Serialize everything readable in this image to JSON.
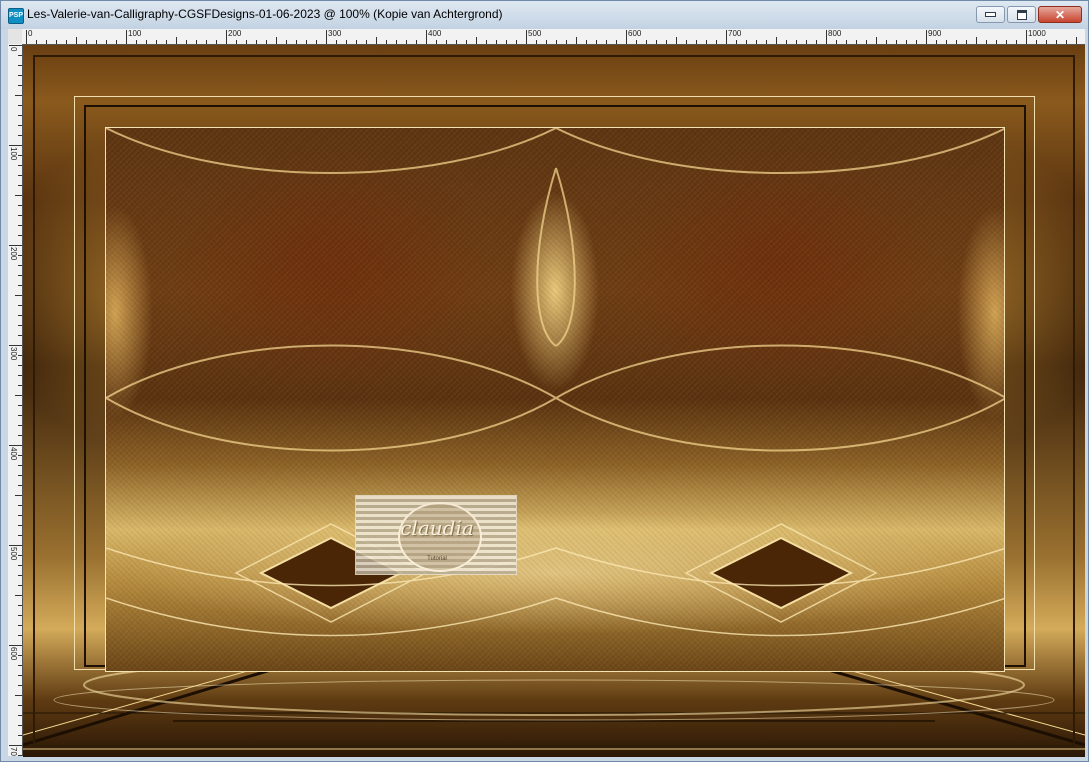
{
  "window": {
    "title": "Les-Valerie-van-Calligraphy-CGSFDesigns-01-06-2023 @ 100% (Kopie van Achtergrond)",
    "app_icon": "psp-app-icon",
    "app_icon_text": "PSP"
  },
  "controls": {
    "minimize_icon": "minimize-icon",
    "maximize_icon": "maximize-icon",
    "close_icon": "close-icon",
    "close_glyph": "✕"
  },
  "ruler": {
    "top_labels": [
      "0",
      "100",
      "200",
      "300",
      "400",
      "500",
      "600",
      "700",
      "800",
      "900",
      "1000"
    ],
    "left_labels": [
      "0",
      "100",
      "200",
      "300",
      "400",
      "500",
      "600",
      "700"
    ]
  },
  "watermark": {
    "text": "claudia",
    "subtext": "Tutorial"
  },
  "colors": {
    "titlebar": "#c9d6e4",
    "art_dark": "#3d230b",
    "art_gold": "#d4ab5a",
    "frame_light": "#f1dfae"
  }
}
